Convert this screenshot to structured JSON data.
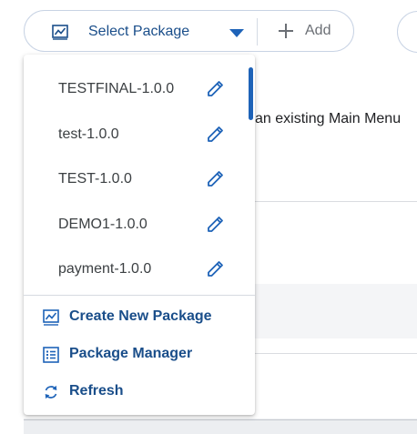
{
  "toolbar": {
    "select_label": "Select Package",
    "add_label": "Add"
  },
  "background": {
    "text": "an existing Main Menu"
  },
  "packages": [
    {
      "name": "TESTFINAL-1.0.0"
    },
    {
      "name": "test-1.0.0"
    },
    {
      "name": "TEST-1.0.0"
    },
    {
      "name": "DEMO1-1.0.0"
    },
    {
      "name": "payment-1.0.0"
    }
  ],
  "actions": {
    "create": "Create New Package",
    "manager": "Package Manager",
    "refresh": "Refresh"
  },
  "colors": {
    "accent": "#1a4e8a",
    "icon_blue": "#1e63b8",
    "border": "#c8d3e4"
  },
  "icons": {
    "package": "package-chart-icon",
    "caret": "caret-down-icon",
    "add": "plus-icon",
    "edit": "pencil-icon",
    "manager": "list-icon",
    "refresh": "refresh-icon"
  }
}
